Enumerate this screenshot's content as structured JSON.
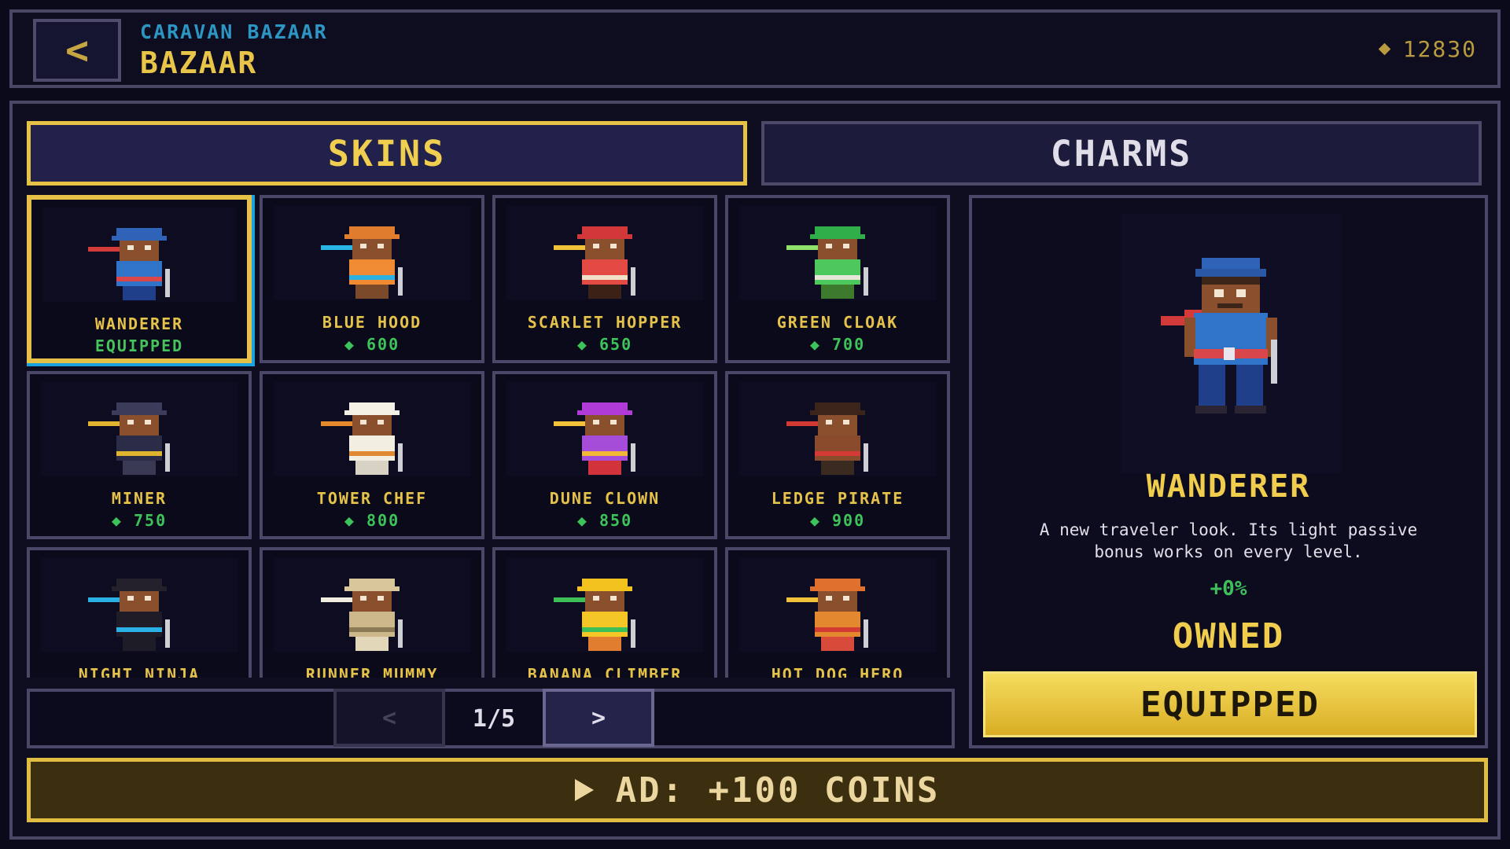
{
  "header": {
    "back_label": "<",
    "kicker": "CARAVAN BAZAAR",
    "title": "BAZAAR",
    "coins": "12830"
  },
  "tabs": [
    {
      "label": "SKINS",
      "active": true
    },
    {
      "label": "CHARMS",
      "active": false
    }
  ],
  "skins": [
    {
      "name": "WANDERER",
      "sub": "EQUIPPED",
      "status": "equipped",
      "hat": "#2f63b8",
      "body": "#2f74c9",
      "belt": "#d9474a",
      "legs": "#1f3f8a",
      "scarf": "#d33a3a",
      "selected": true
    },
    {
      "name": "BLUE HOOD",
      "sub": "600",
      "status": "price",
      "hat": "#e07c2e",
      "body": "#f08a33",
      "belt": "#2cb2e0",
      "legs": "#7b4a2a",
      "scarf": "#29b6e6"
    },
    {
      "name": "SCARLET HOPPER",
      "sub": "650",
      "status": "price",
      "hat": "#d2383a",
      "body": "#e24a43",
      "belt": "#f0e0c8",
      "legs": "#3c2216",
      "scarf": "#f0c23a"
    },
    {
      "name": "GREEN CLOAK",
      "sub": "700",
      "status": "price",
      "hat": "#2fae4a",
      "body": "#4cc85c",
      "belt": "#e6e6d8",
      "legs": "#3d7a2e",
      "scarf": "#8ee06a"
    },
    {
      "name": "MINER",
      "sub": "750",
      "status": "price",
      "hat": "#3a3c5a",
      "body": "#2b2d48",
      "belt": "#e0b42e",
      "legs": "#3a3954",
      "scarf": "#e0b42e"
    },
    {
      "name": "TOWER CHEF",
      "sub": "800",
      "status": "price",
      "hat": "#f4f0e6",
      "body": "#f3eee2",
      "belt": "#e08a36",
      "legs": "#d8d2c4",
      "scarf": "#e58a2c"
    },
    {
      "name": "DUNE CLOWN",
      "sub": "850",
      "status": "price",
      "hat": "#b13bd6",
      "body": "#a54cd8",
      "belt": "#f0b835",
      "legs": "#d2333a",
      "scarf": "#f4c23a"
    },
    {
      "name": "LEDGE PIRATE",
      "sub": "900",
      "status": "price",
      "hat": "#3b2419",
      "body": "#8a4a2c",
      "belt": "#d43a34",
      "legs": "#3b2a20",
      "scarf": "#d43a34"
    },
    {
      "name": "NIGHT NINJA",
      "sub": "",
      "status": "price",
      "hat": "#24202c",
      "body": "#1f1c28",
      "belt": "#2bb0e6",
      "legs": "#1e1c27",
      "scarf": "#2bb0e6"
    },
    {
      "name": "RUNNER MUMMY",
      "sub": "",
      "status": "price",
      "hat": "#d8c79a",
      "body": "#cdb88c",
      "belt": "#8a7a55",
      "legs": "#e2d7b8",
      "scarf": "#f0ece0"
    },
    {
      "name": "BANANA CLIMBER",
      "sub": "",
      "status": "price",
      "hat": "#f2c21e",
      "body": "#f4c727",
      "belt": "#3dbf58",
      "legs": "#e07d2e",
      "scarf": "#3dbf58"
    },
    {
      "name": "HOT DOG HERO",
      "sub": "",
      "status": "price",
      "hat": "#e0702e",
      "body": "#e48830",
      "belt": "#d33a34",
      "legs": "#d84b3a",
      "scarf": "#f2c23a"
    }
  ],
  "pager": {
    "prev_label": "<",
    "next_label": ">",
    "page_label": "1/5"
  },
  "detail": {
    "name": "WANDERER",
    "description": "A new traveler look. Its light passive bonus works on every level.",
    "bonus": "+0%",
    "status": "OWNED",
    "button_label": "EQUIPPED"
  },
  "ad": {
    "label": "AD: +100 COINS"
  },
  "colors": {
    "accent_gold": "#e5c245",
    "selection_blue": "#1aa2e0",
    "price_green": "#3ec25a",
    "background": "#0b0a1a"
  },
  "icons": {
    "back": "chevron-left-icon",
    "coin": "gem-icon",
    "ad": "play-icon"
  }
}
